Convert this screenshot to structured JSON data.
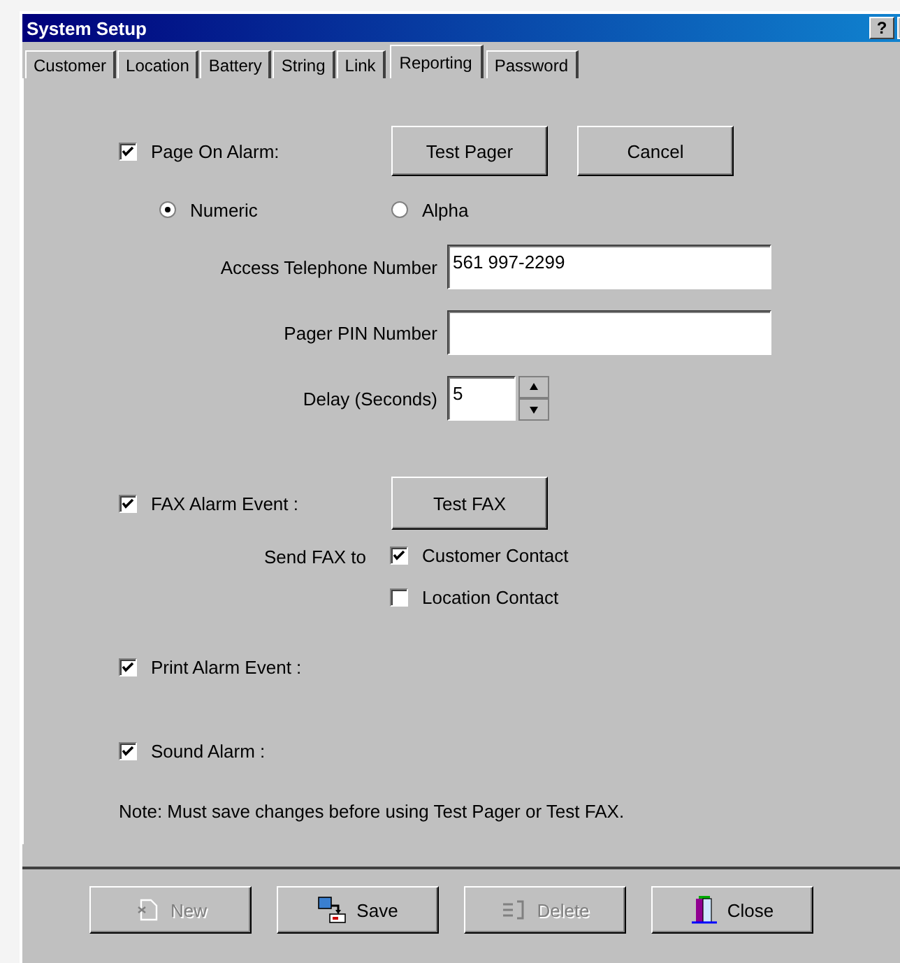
{
  "window": {
    "title": "System Setup",
    "title_buttons": [
      "?"
    ]
  },
  "tabs": [
    {
      "label": "Customer",
      "selected": false
    },
    {
      "label": "Location",
      "selected": false
    },
    {
      "label": "Battery",
      "selected": false
    },
    {
      "label": "String",
      "selected": false
    },
    {
      "label": "Link",
      "selected": false
    },
    {
      "label": "Reporting",
      "selected": true
    },
    {
      "label": "Password",
      "selected": false
    }
  ],
  "page_on_alarm": {
    "label": "Page On Alarm:",
    "checked": true,
    "buttons": [
      "Test Pager",
      "Cancel"
    ],
    "modes": [
      {
        "label": "Numeric",
        "selected": true
      },
      {
        "label": "Alpha",
        "selected": false
      }
    ],
    "fields": [
      {
        "label": "Access Telephone Number",
        "value": "561 997-2299"
      },
      {
        "label": "Pager PIN Number"
      }
    ],
    "delay": {
      "label": "Delay (Seconds)",
      "value": "5"
    }
  },
  "fax_alarm": {
    "label": "FAX Alarm Event :",
    "checked": true,
    "button": "Test FAX",
    "send_to_label": "Send FAX to",
    "recipients": [
      {
        "label": "Customer Contact",
        "checked": true
      },
      {
        "label": "Location Contact",
        "checked": false
      }
    ]
  },
  "print_alarm": {
    "label": "Print Alarm Event :",
    "checked": true
  },
  "sound_alarm": {
    "label": "Sound Alarm :",
    "checked": true
  },
  "note": "Note:  Must save changes before using Test Pager or Test FAX.",
  "footer_buttons": [
    {
      "kind": "new",
      "label": "New",
      "disabled": true
    },
    {
      "kind": "save",
      "label": "Save",
      "disabled": false
    },
    {
      "kind": "delete",
      "label": "Delete",
      "disabled": true
    },
    {
      "kind": "close",
      "label": "Close",
      "disabled": false
    }
  ]
}
